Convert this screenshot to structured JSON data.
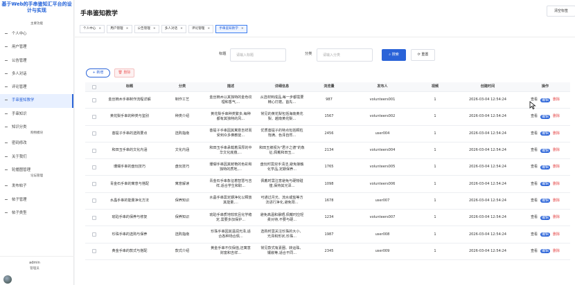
{
  "sidebar": {
    "title": "基于Web的手串鉴知汇平台的设计与实现",
    "sections": {
      "main": "主要功能",
      "shopping": "购物模块",
      "forum": "论坛管理"
    },
    "items": [
      {
        "label": "个人中心"
      },
      {
        "label": "用户管理"
      },
      {
        "label": "公告管理"
      },
      {
        "label": "多人对话"
      },
      {
        "label": "评论管理"
      },
      {
        "label": "手串鉴知教学"
      },
      {
        "label": "手串知识"
      },
      {
        "label": "知识分类"
      },
      {
        "label": "密码修改"
      },
      {
        "label": "关于我们"
      },
      {
        "label": "轮播图管理"
      },
      {
        "label": "发布帖子"
      },
      {
        "label": "帖子管理"
      },
      {
        "label": "帖子类型"
      }
    ],
    "user": {
      "name": "admin",
      "role": "管理员"
    }
  },
  "header": {
    "title": "手串鉴知教学",
    "clear_tags_label": "清空标签"
  },
  "tabs": [
    {
      "label": "个人中心",
      "active": false
    },
    {
      "label": "用户管理",
      "active": false
    },
    {
      "label": "公告管理",
      "active": false
    },
    {
      "label": "多人对话",
      "active": false
    },
    {
      "label": "评论管理",
      "active": false
    },
    {
      "label": "手串鉴知教学",
      "active": true
    }
  ],
  "search": {
    "title_label": "标题",
    "title_placeholder": "请输入标题",
    "category_label": "分类",
    "category_placeholder": "请输入分类",
    "search_button": "搜索",
    "reset_button": "重置"
  },
  "toolbar": {
    "add_label": "+ 新增",
    "delete_label": "删除"
  },
  "table": {
    "columns": [
      "标题",
      "分类",
      "描述",
      "详细信息",
      "浏览量",
      "发布人",
      "视频",
      "创建时间",
      "操作"
    ],
    "actions": {
      "view": "查看",
      "edit": "编辑",
      "delete": "删除"
    },
    "rows": [
      {
        "title": "金丝楠木手串制作流程详解",
        "category": "制作工艺",
        "description": "金丝楠木以其独特的金色纹理和香气,...",
        "detail": "从选材到成品,每一步都需要精心打磨。首先...",
        "views": "987",
        "publisher": "volunteers001",
        "video": "1",
        "created": "2026-03-04 12:54:24"
      },
      {
        "title": "黄花梨手串的种类与鉴别",
        "category": "种类介绍",
        "description": "黄花梨手串种类繁多,每种都有其独特的风...",
        "detail": "常见的黄花梨包括海南黄花梨、越南黄花梨...",
        "views": "1567",
        "publisher": "volunteers002",
        "video": "1",
        "created": "2026-03-04 12:54:24"
      },
      {
        "title": "菩提子手串的选购要点",
        "category": "选购指南",
        "description": "菩提子手串因其寓意吉祥而受到众多佛教徒...",
        "detail": "优质菩提子的特点包括颗粒饱满、色泽自然...",
        "views": "2456",
        "publisher": "user004",
        "video": "1",
        "created": "2026-03-04 12:54:24"
      },
      {
        "title": "和田玉手串的文化内涵",
        "category": "文化内涵",
        "description": "和田玉手串承载着深厚的中华文化底蕴,...",
        "detail": "和田玉被视为\"君子之德\"的象征,佩戴和田玉...",
        "views": "2134",
        "publisher": "volunteers004",
        "video": "1",
        "created": "2026-03-04 12:54:24"
      },
      {
        "title": "珊瑚手串的盘玩技巧",
        "category": "盘玩技巧",
        "description": "珊瑚手串因其鲜艳的色彩和独特的质地,...",
        "detail": "盘玩时需双手清洁,避免接触化学品,定期保养...",
        "views": "1765",
        "publisher": "volunteers005",
        "video": "1",
        "created": "2026-03-04 12:54:24"
      },
      {
        "title": "青金石手串的寓意与搭配",
        "category": "寓意解读",
        "description": "青金石手串象征着智慧与吉祥,适合学生和职...",
        "detail": "佩戴时需注意避免与硬物碰撞,保持其光泽...",
        "views": "1098",
        "publisher": "volunteers006",
        "video": "1",
        "created": "2026-03-04 12:54:24"
      },
      {
        "title": "水晶手串的能量净化方法",
        "category": "保养知识",
        "description": "水晶手串需定期净化以释放其能量,...",
        "detail": "可通过月光、流水或盐等方法进行净化,避免阳...",
        "views": "1678",
        "publisher": "user007",
        "video": "1",
        "created": "2026-03-04 12:54:24"
      },
      {
        "title": "琥珀手串的保养与修复",
        "category": "保养知识",
        "description": "琥珀手串质地较软且化学稳定,需要多加保护...",
        "detail": "避免高温和暴晒,佩戴时应轻柔对待,不要与硬...",
        "views": "1234",
        "publisher": "volunteers007",
        "video": "1",
        "created": "2026-03-04 12:54:24"
      },
      {
        "title": "珍珠手串的选购与保养",
        "category": "选购指南",
        "description": "珍珠手串因其温润光泽,适合各种场合佩...",
        "detail": "选购时需关注珍珠的大小、光泽和形状,珍珠...",
        "views": "1987",
        "publisher": "user008",
        "video": "1",
        "created": "2026-03-04 12:54:24"
      },
      {
        "title": "黄金手串的款式与搭配",
        "category": "款式介绍",
        "description": "黄金手串不仅保值,还寓意财富和吉祥...",
        "detail": "常见款式有素圈、转运珠、镶嵌等,适合不同...",
        "views": "2345",
        "publisher": "user009",
        "video": "1",
        "created": "2026-03-04 12:54:24"
      }
    ]
  }
}
